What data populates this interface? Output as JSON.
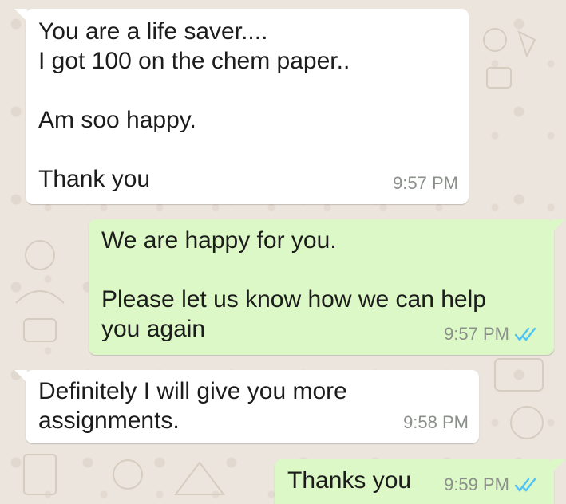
{
  "chat": {
    "messages": [
      {
        "direction": "incoming",
        "text": "You are a life saver....\nI got 100 on the chem paper..\n\nAm soo happy.\n\nThank you",
        "time": "9:57 PM"
      },
      {
        "direction": "outgoing",
        "text": "We are happy for you.\n\nPlease let us know how we can help\nyou again",
        "time": "9:57 PM",
        "status": "read-double-check-icon"
      },
      {
        "direction": "incoming",
        "text": "Definitely I will give you more\nassignments.",
        "time": "9:58 PM"
      },
      {
        "direction": "outgoing",
        "text": "Thanks you",
        "time": "9:59 PM",
        "status": "read-double-check-icon"
      }
    ]
  },
  "colors": {
    "background": "#ece5dd",
    "incoming_bubble": "#ffffff",
    "outgoing_bubble": "#dcf8c6",
    "read_tick": "#4fc3f7",
    "timestamp": "#8a8f8a"
  }
}
